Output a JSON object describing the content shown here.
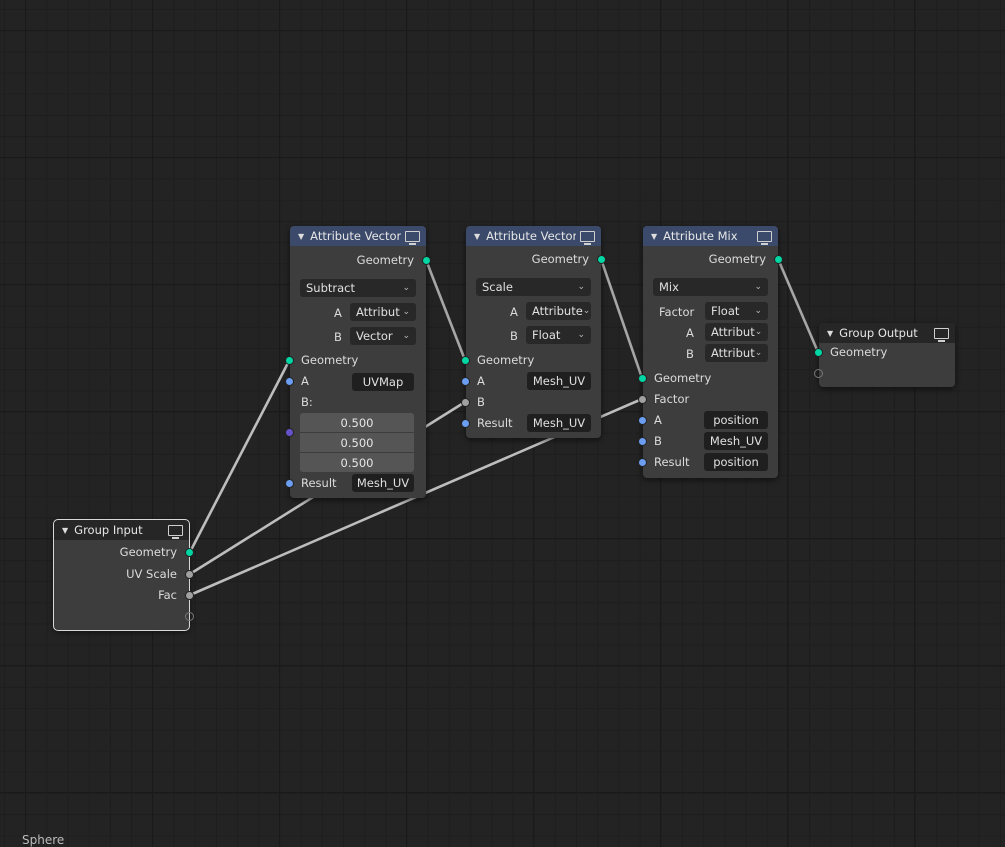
{
  "editor": {
    "type": "Geometry Node Editor",
    "status_text": "Sphere"
  },
  "colors": {
    "socket_geometry": "#00d6a3",
    "socket_vector": "#6b9df0",
    "socket_float": "#a1a1a1",
    "socket_vector_purple": "#6352c8",
    "header_attribute": "#3b4a6a",
    "header_group": "#262626",
    "link": "#bdbdbd"
  },
  "nodes": {
    "attr_vector_1": {
      "title": "Attribute Vector",
      "output": "Geometry",
      "operation": "Subtract",
      "a_label": "A",
      "a_type": "Attribut",
      "b_label": "B",
      "b_type": "Vector",
      "in_geometry": "Geometry",
      "in_a": "A",
      "in_a_value": "UVMap",
      "in_b": "B:",
      "b_values": [
        "0.500",
        "0.500",
        "0.500"
      ],
      "in_result": "Result",
      "result_value": "Mesh_UV"
    },
    "attr_vector_2": {
      "title": "Attribute Vector",
      "output": "Geometry",
      "operation": "Scale",
      "a_label": "A",
      "a_type": "Attribute",
      "b_label": "B",
      "b_type": "Float",
      "in_geometry": "Geometry",
      "in_a": "A",
      "in_a_value": "Mesh_UV",
      "in_b": "B",
      "in_result": "Result",
      "result_value": "Mesh_UV"
    },
    "attr_mix": {
      "title": "Attribute Mix",
      "output": "Geometry",
      "operation": "Mix",
      "factor_label": "Factor",
      "factor_type": "Float",
      "a_label": "A",
      "a_type": "Attribut",
      "b_label": "B",
      "b_type": "Attribut",
      "in_geometry": "Geometry",
      "in_factor": "Factor",
      "in_a": "A",
      "in_a_value": "position",
      "in_b": "B",
      "in_b_value": "Mesh_UV",
      "in_result": "Result",
      "result_value": "position"
    },
    "group_output": {
      "title": "Group Output",
      "in_geometry": "Geometry"
    },
    "group_input": {
      "title": "Group Input",
      "outputs": [
        "Geometry",
        "UV Scale",
        "Fac"
      ]
    }
  },
  "links": [
    {
      "from": "group_input.Geometry",
      "to": "attr_vector_1.Geometry"
    },
    {
      "from": "group_input.UV Scale",
      "to": "attr_vector_2.B"
    },
    {
      "from": "group_input.Fac",
      "to": "attr_mix.Factor"
    },
    {
      "from": "attr_vector_1.Geometry",
      "to": "attr_vector_2.Geometry"
    },
    {
      "from": "attr_vector_2.Geometry",
      "to": "attr_mix.Geometry"
    },
    {
      "from": "attr_mix.Geometry",
      "to": "group_output.Geometry"
    }
  ]
}
